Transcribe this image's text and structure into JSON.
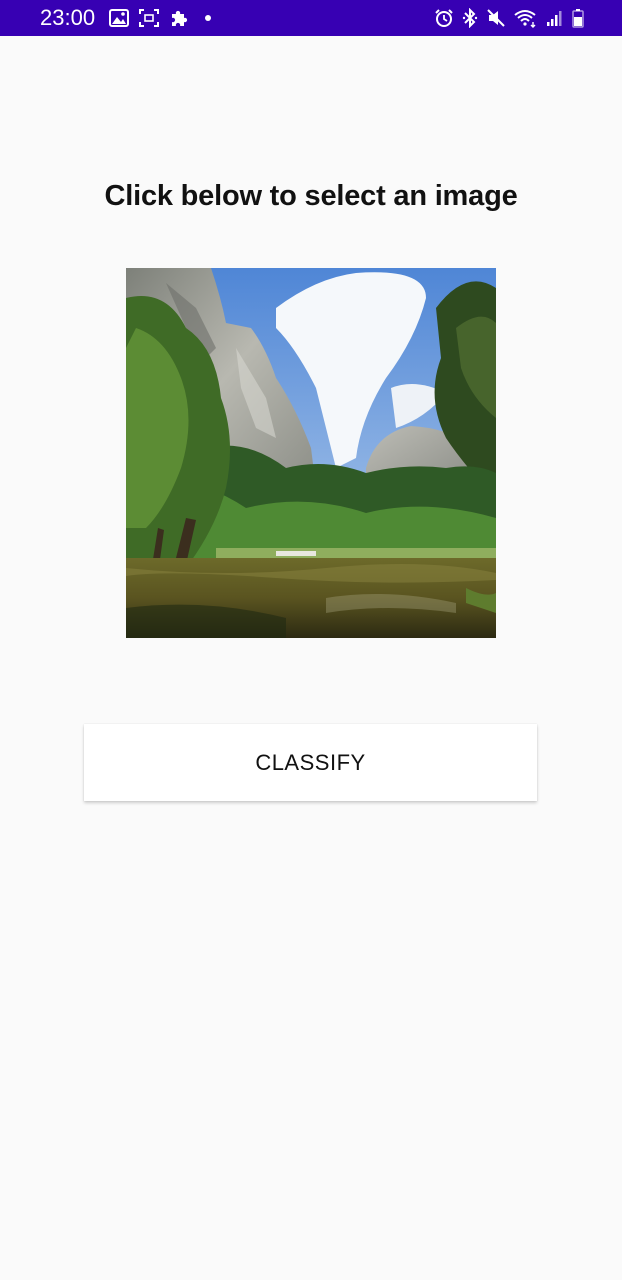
{
  "status_bar": {
    "time": "23:00",
    "background_color": "#3700b3",
    "left_icons": [
      "gallery-icon",
      "screen-capture-icon",
      "puzzle-icon",
      "notification-dot-icon"
    ],
    "right_icons": [
      "alarm-icon",
      "bluetooth-icon",
      "mute-icon",
      "wifi-icon",
      "signal-icon",
      "battery-icon"
    ]
  },
  "main": {
    "title": "Click below to select an image",
    "image": {
      "description_icon": "landscape-image",
      "interactable": true
    },
    "classify_button": {
      "label": "CLASSIFY"
    }
  },
  "colors": {
    "background": "#fafafa",
    "button_background": "#ffffff",
    "text": "#111111"
  }
}
